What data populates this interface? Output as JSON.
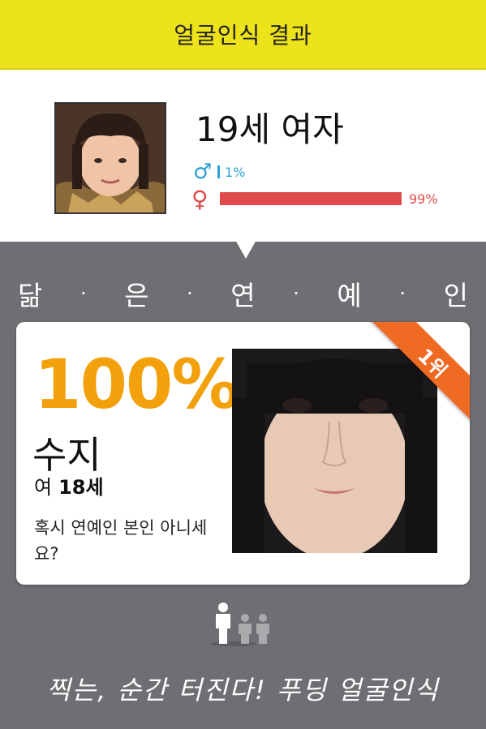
{
  "header": {
    "title": "얼굴인식 결과"
  },
  "profile": {
    "age_gender": "19세 여자",
    "male_symbol": "♂",
    "male_percent": "1%",
    "male_fraction": 0.01,
    "female_symbol": "♀",
    "female_percent": "99%",
    "female_fraction": 0.99
  },
  "section": {
    "chars": [
      "닮",
      "은",
      "연",
      "예",
      "인"
    ],
    "separator": "·"
  },
  "match": {
    "rank": "1위",
    "percent": "100%",
    "name": "수지",
    "gender": "여",
    "age": "18세",
    "question": "혹시 연예인 본인 아니세요?"
  },
  "footer": {
    "slogan": "찍는, 순간 터진다! 푸딩 얼굴인식"
  },
  "colors": {
    "header_bg": "#ece31a",
    "male": "#2e9fd6",
    "female": "#e04b4b",
    "accent_orange": "#f2a10c",
    "ribbon": "#ef6a23",
    "background": "#6d6f72"
  },
  "icons": [
    "male-icon",
    "female-icon",
    "people-icon"
  ]
}
